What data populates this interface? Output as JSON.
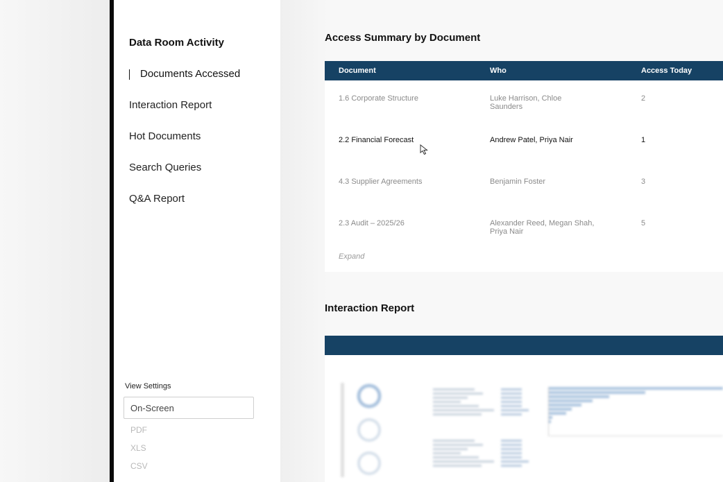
{
  "sidebar": {
    "title": "Data Room Activity",
    "items": [
      {
        "label": "Documents Accessed",
        "active": true
      },
      {
        "label": "Interaction Report"
      },
      {
        "label": "Hot Documents"
      },
      {
        "label": "Search Queries"
      },
      {
        "label": "Q&A Report"
      }
    ],
    "view_settings": {
      "label": "View Settings",
      "selected": "On-Screen",
      "options": [
        "PDF",
        "XLS",
        "CSV"
      ]
    }
  },
  "access_summary": {
    "title": "Access Summary by Document",
    "columns": [
      "Document",
      "Who",
      "Access Today"
    ],
    "rows": [
      {
        "document": "1.6 Corporate Structure",
        "who_line1": "Luke Harrison, Chloe",
        "who_line2": "Saunders",
        "count": "2"
      },
      {
        "document": "2.2 Financial Forecast",
        "who_line1": "Andrew Patel, Priya Nair",
        "who_line2": "",
        "count": "1",
        "highlighted": true
      },
      {
        "document": "4.3 Supplier Agreements",
        "who_line1": "Benjamin Foster",
        "who_line2": "",
        "count": "3"
      },
      {
        "document": "2.3 Audit – 2025/26",
        "who_line1": "Alexander Reed, Megan Shah,",
        "who_line2": "Priya Nair",
        "count": "5"
      }
    ],
    "expand_label": "Expand"
  },
  "interaction_report": {
    "title": "Interaction Report"
  },
  "colors": {
    "header_bg": "#164264",
    "accent_bar": "#0a0a0a",
    "chart_blue": "#8fb0d4"
  }
}
